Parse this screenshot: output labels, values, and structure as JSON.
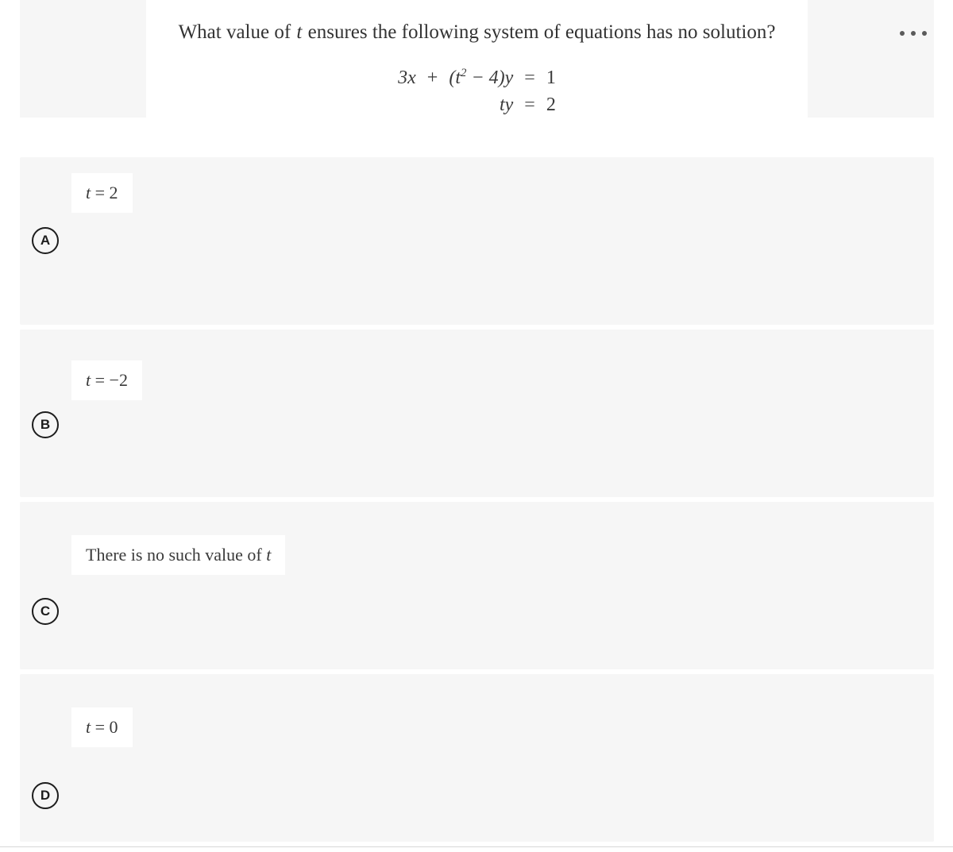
{
  "header": {
    "question_text_parts": {
      "before": "What value of ",
      "variable": "t",
      "after": " ensures the following system of equations has no solution?"
    },
    "question_text": "What value of t ensures the following system of equations has no solution?",
    "overflow_menu_label": "•••"
  },
  "equations": {
    "rows": [
      {
        "lhs": "3x",
        "operator": "+",
        "middle_coefficient": "(t",
        "middle_exponent": "2",
        "middle_rest": " − 4)y",
        "relation": "=",
        "rhs": "1"
      },
      {
        "lhs": "",
        "operator": "",
        "middle_coefficient": "",
        "middle_exponent": "",
        "middle_rest": "ty",
        "relation": "=",
        "rhs": "2"
      }
    ],
    "equation_1_plain": "3x + (t^2 - 4)y = 1",
    "equation_2_plain": "ty = 2"
  },
  "options": [
    {
      "letter": "A",
      "text": "t = 2",
      "variable": "t",
      "relation": "=",
      "value": "2"
    },
    {
      "letter": "B",
      "text": "t = -2",
      "variable": "t",
      "relation": "=",
      "value": "−2"
    },
    {
      "letter": "C",
      "text": "There is no such value of t",
      "prefix": "There is no such value of ",
      "variable": "t",
      "relation": "",
      "value": ""
    },
    {
      "letter": "D",
      "text": "t = 0",
      "variable": "t",
      "relation": "=",
      "value": "0"
    }
  ],
  "colors": {
    "panel_background": "#f6f6f6",
    "content_background": "#ffffff",
    "text": "#333333",
    "badge_border": "#1d1d1d",
    "divider": "#d7d7d7",
    "menu_dot": "#5a5a5a"
  }
}
